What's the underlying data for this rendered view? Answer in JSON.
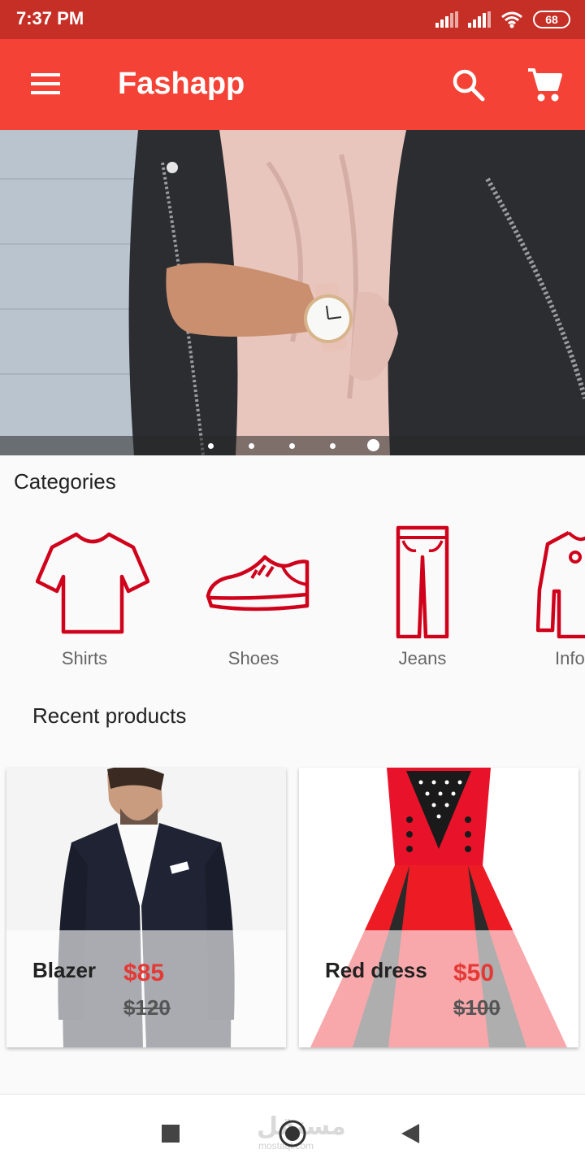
{
  "status_bar": {
    "time": "7:37 PM",
    "battery": "68"
  },
  "app_bar": {
    "title": "Fashapp",
    "icons": [
      "menu-icon",
      "search-icon",
      "cart-icon"
    ]
  },
  "carousel": {
    "dot_count": 5,
    "active_index": 4
  },
  "categories": {
    "title": "Categories",
    "items": [
      {
        "label": "Shirts",
        "icon": "shirt-icon"
      },
      {
        "label": "Shoes",
        "icon": "shoe-icon"
      },
      {
        "label": "Jeans",
        "icon": "jeans-icon"
      },
      {
        "label": "Info",
        "icon": "jacket-icon"
      }
    ]
  },
  "recent": {
    "title": "Recent products",
    "products": [
      {
        "name": "Blazer",
        "price": "$85",
        "old_price": "$120"
      },
      {
        "name": "Red dress",
        "price": "$50",
        "old_price": "$100"
      }
    ]
  },
  "nav": {
    "watermark": "مستقل",
    "watermark_sub": "mostaql.com"
  },
  "colors": {
    "primary": "#f44336",
    "status": "#c62f26",
    "accent_icon": "#d0021b",
    "price": "#e53935"
  }
}
